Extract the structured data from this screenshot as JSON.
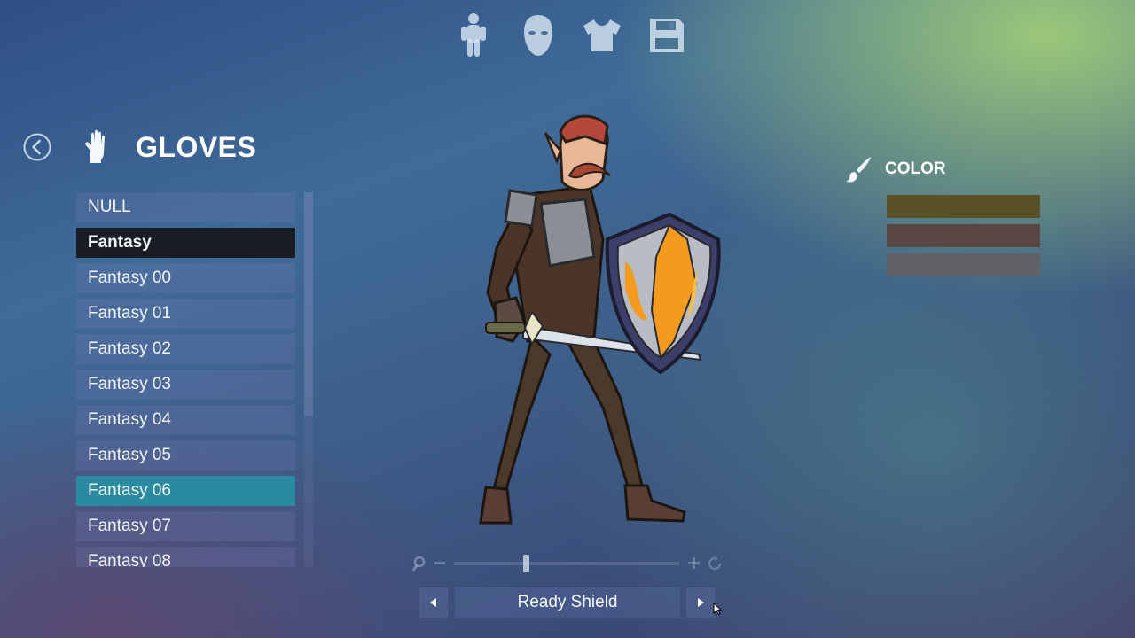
{
  "top_nav": {
    "tabs": [
      {
        "name": "body-tab",
        "icon": "body-icon"
      },
      {
        "name": "head-tab",
        "icon": "face-icon"
      },
      {
        "name": "clothing-tab",
        "icon": "shirt-icon"
      },
      {
        "name": "save-tab",
        "icon": "save-icon"
      }
    ]
  },
  "header": {
    "back_icon": "back-arrow-icon",
    "category_icon": "glove-icon",
    "title": "GLOVES"
  },
  "items": [
    {
      "label": "NULL",
      "state": "normal"
    },
    {
      "label": "Fantasy",
      "state": "selected"
    },
    {
      "label": "Fantasy 00",
      "state": "normal"
    },
    {
      "label": "Fantasy 01",
      "state": "normal"
    },
    {
      "label": "Fantasy 02",
      "state": "normal"
    },
    {
      "label": "Fantasy 03",
      "state": "normal"
    },
    {
      "label": "Fantasy 04",
      "state": "normal"
    },
    {
      "label": "Fantasy 05",
      "state": "normal"
    },
    {
      "label": "Fantasy 06",
      "state": "active"
    },
    {
      "label": "Fantasy 07",
      "state": "normal"
    },
    {
      "label": "Fantasy 08",
      "state": "normal"
    }
  ],
  "color_panel": {
    "icon": "brush-icon",
    "title": "COLOR",
    "swatches": [
      "#5a5128",
      "#5a4642",
      "#636067"
    ]
  },
  "animation": {
    "label": "Ready Shield"
  },
  "accent": {
    "selected_bg": "#1a1d24",
    "active_bg": "#2a8aa0"
  }
}
